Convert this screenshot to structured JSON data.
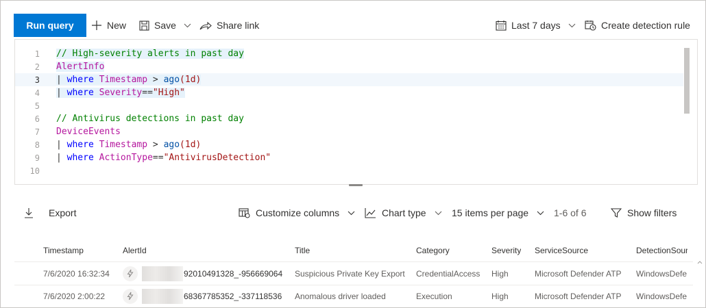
{
  "toolbar": {
    "run_query": "Run query",
    "new": "New",
    "save": "Save",
    "share_link": "Share link",
    "time_range": "Last 7 days",
    "create_rule": "Create detection rule"
  },
  "editor": {
    "line_numbers": [
      "1",
      "2",
      "3",
      "4",
      "5",
      "6",
      "7",
      "8",
      "9",
      "10"
    ],
    "lines": {
      "l1": "// High-severity alerts in past day",
      "l2": "AlertInfo",
      "l3_pipe": "| ",
      "l3_where": "where",
      "l3_col": "Timestamp",
      "l3_op": " > ",
      "l3_fn": "ago",
      "l3_arg": "(1d)",
      "l4_pipe": "| ",
      "l4_where": "where",
      "l4_col": "Severity",
      "l4_op": "==",
      "l4_str": "\"High\"",
      "l6": "// Antivirus detections in past day",
      "l7": "DeviceEvents",
      "l8_pipe": "| ",
      "l8_where": "where",
      "l8_col": "Timestamp",
      "l8_op": " > ",
      "l8_fn": "ago",
      "l8_arg": "(1d)",
      "l9_pipe": "| ",
      "l9_where": "where",
      "l9_col": "ActionType",
      "l9_op": "==",
      "l9_str": "\"AntivirusDetection\""
    }
  },
  "results": {
    "export": "Export",
    "customize_columns": "Customize columns",
    "chart_type": "Chart type",
    "items_per_page": "15 items per page",
    "range": "1-6 of 6",
    "show_filters": "Show filters"
  },
  "table": {
    "headers": {
      "timestamp": "Timestamp",
      "alertid": "AlertId",
      "title": "Title",
      "category": "Category",
      "severity": "Severity",
      "servicesource": "ServiceSource",
      "detectionsource": "DetectionSour"
    },
    "rows": [
      {
        "timestamp": "7/6/2020 16:32:34",
        "alertid": "92010491328_-956669064",
        "title": "Suspicious Private Key Export",
        "category": "CredentialAccess",
        "severity": "High",
        "servicesource": "Microsoft Defender ATP",
        "detectionsource": "WindowsDefe"
      },
      {
        "timestamp": "7/6/2020 2:00:22",
        "alertid": "68367785352_-337118536",
        "title": "Anomalous driver loaded",
        "category": "Execution",
        "severity": "High",
        "servicesource": "Microsoft Defender ATP",
        "detectionsource": "WindowsDefe"
      }
    ]
  },
  "colors": {
    "accent": "#0078d4",
    "comment": "#008000",
    "keyword": "#0000ff",
    "table": "#b5179e",
    "string": "#a31515"
  }
}
